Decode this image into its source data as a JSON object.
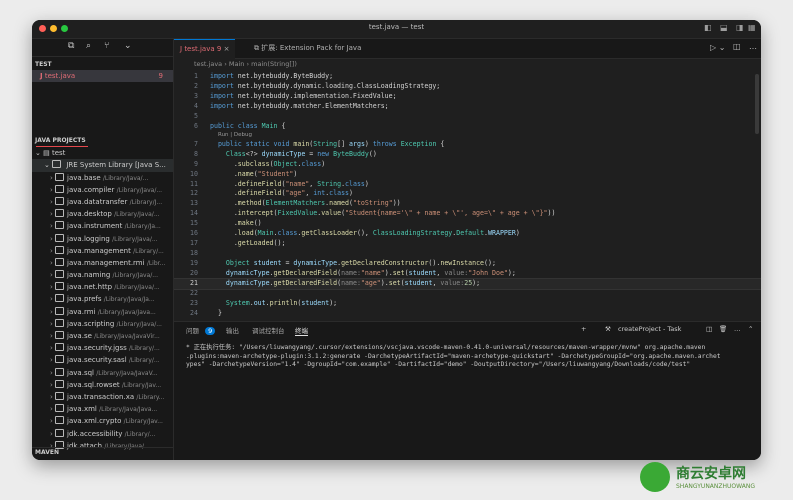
{
  "window": {
    "title": "test.java — test"
  },
  "sidebar": {
    "top_icons": [
      "files-icon",
      "search-icon",
      "branch-icon",
      "chevron-down-icon"
    ],
    "open_section": "TEST",
    "open_file": {
      "name": "test.java",
      "count": "9"
    },
    "java_projects": "JAVA PROJECTS",
    "project": "test",
    "jre": "JRE System Library [Java S...",
    "packages": [
      {
        "name": "java.base",
        "path": "/Library/Java/..."
      },
      {
        "name": "java.compiler",
        "path": "/Library/Java/..."
      },
      {
        "name": "java.datatransfer",
        "path": "/Library/J..."
      },
      {
        "name": "java.desktop",
        "path": "/Library/Java/..."
      },
      {
        "name": "java.instrument",
        "path": "/Library/Ja..."
      },
      {
        "name": "java.logging",
        "path": "/Library/Java/..."
      },
      {
        "name": "java.management",
        "path": "/Library/..."
      },
      {
        "name": "java.management.rmi",
        "path": "/Libr..."
      },
      {
        "name": "java.naming",
        "path": "/Library/Java/..."
      },
      {
        "name": "java.net.http",
        "path": "/Library/Java/..."
      },
      {
        "name": "java.prefs",
        "path": "/Library/Java/Ja..."
      },
      {
        "name": "java.rmi",
        "path": "/Library/Java/Java..."
      },
      {
        "name": "java.scripting",
        "path": "/Library/Java/..."
      },
      {
        "name": "java.se",
        "path": "/Library/Java/JavaVir..."
      },
      {
        "name": "java.security.jgss",
        "path": "/Library/..."
      },
      {
        "name": "java.security.sasl",
        "path": "/Library/..."
      },
      {
        "name": "java.sql",
        "path": "/Library/Java/JavaV..."
      },
      {
        "name": "java.sql.rowset",
        "path": "/Library/Jav..."
      },
      {
        "name": "java.transaction.xa",
        "path": "/Library..."
      },
      {
        "name": "java.xml",
        "path": "/Library/Java/Java..."
      },
      {
        "name": "java.xml.crypto",
        "path": "/Library/Jav..."
      },
      {
        "name": "jdk.accessibility",
        "path": "/Library/..."
      },
      {
        "name": "jdk.attach",
        "path": "/Library/Java/..."
      }
    ],
    "maven": "MAVEN"
  },
  "tabs": [
    {
      "label": "test.java",
      "badge": "9"
    },
    {
      "label": "扩展: Extension Pack for Java"
    }
  ],
  "breadcrumbs": [
    "test.java",
    "Main",
    "main(String[])"
  ],
  "codelens": "Run | Debug",
  "active_line": 21,
  "lines": [
    {
      "n": "1",
      "html": "<span class='kw'>import</span> net.bytebuddy.ByteBuddy;"
    },
    {
      "n": "2",
      "html": "<span class='kw'>import</span> net.bytebuddy.dynamic.loading.ClassLoadingStrategy;"
    },
    {
      "n": "3",
      "html": "<span class='kw'>import</span> net.bytebuddy.implementation.FixedValue;"
    },
    {
      "n": "4",
      "html": "<span class='kw'>import</span> net.bytebuddy.matcher.ElementMatchers;"
    },
    {
      "n": "5",
      "html": ""
    },
    {
      "n": "6",
      "html": "<span class='kw'>public class</span> <span class='ty'>Main</span> {"
    },
    {
      "n": "7",
      "html": "  <span class='kw'>public static void</span> <span class='fn'>main</span>(<span class='ty'>String</span>[] <span class='vr'>args</span>) <span class='kw'>throws</span> <span class='ty'>Exception</span> {"
    },
    {
      "n": "8",
      "html": "    <span class='ty'>Class</span>&lt;?&gt; <span class='vr'>dynamicType</span> = <span class='kw'>new</span> <span class='ty'>ByteBuddy</span>()"
    },
    {
      "n": "9",
      "html": "      .<span class='fn'>subclass</span>(<span class='ty'>Object</span>.<span class='kw'>class</span>)"
    },
    {
      "n": "10",
      "html": "      .<span class='fn'>name</span>(<span class='st'>\"Student\"</span>)"
    },
    {
      "n": "11",
      "html": "      .<span class='fn'>defineField</span>(<span class='st'>\"name\"</span>, <span class='ty'>String</span>.<span class='kw'>class</span>)"
    },
    {
      "n": "12",
      "html": "      .<span class='fn'>defineField</span>(<span class='st'>\"age\"</span>, <span class='kw'>int</span>.<span class='kw'>class</span>)"
    },
    {
      "n": "13",
      "html": "      .<span class='fn'>method</span>(<span class='ty'>ElementMatchers</span>.<span class='fn'>named</span>(<span class='st'>\"toString\"</span>))"
    },
    {
      "n": "14",
      "html": "      .<span class='fn'>intercept</span>(<span class='ty'>FixedValue</span>.<span class='fn'>value</span>(<span class='st'>\"Student{name='\\\" + name + \\\"', age=\\\" + age + \\\"}\"</span>))"
    },
    {
      "n": "15",
      "html": "      .<span class='fn'>make</span>()"
    },
    {
      "n": "16",
      "html": "      .<span class='fn'>load</span>(<span class='ty'>Main</span>.<span class='kw'>class</span>.<span class='fn'>getClassLoader</span>(), <span class='ty'>ClassLoadingStrategy</span>.<span class='ty'>Default</span>.<span class='vr'>WRAPPER</span>)"
    },
    {
      "n": "17",
      "html": "      .<span class='fn'>getLoaded</span>();"
    },
    {
      "n": "18",
      "html": ""
    },
    {
      "n": "19",
      "html": "    <span class='ty'>Object</span> <span class='vr'>student</span> = <span class='vr'>dynamicType</span>.<span class='fn'>getDeclaredConstructor</span>().<span class='fn'>newInstance</span>();"
    },
    {
      "n": "20",
      "html": "    <span class='vr'>dynamicType</span>.<span class='fn'>getDeclaredField</span>(<span class='ht'>name:</span><span class='st'>\"name\"</span>).<span class='fn'>set</span>(<span class='vr'>student</span>, <span class='ht'>value:</span><span class='st'>\"John Doe\"</span>);"
    },
    {
      "n": "21",
      "html": "    <span class='vr'>dynamicType</span>.<span class='fn'>getDeclaredField</span>(<span class='ht'>name:</span><span class='st'>\"age\"</span>).<span class='fn'>set</span>(<span class='vr'>student</span>, <span class='ht'>value:</span><span class='ct'>25</span>);"
    },
    {
      "n": "22",
      "html": ""
    },
    {
      "n": "23",
      "html": "    <span class='ty'>System</span>.<span class='vr'>out</span>.<span class='fn'>println</span>(<span class='vr'>student</span>);"
    },
    {
      "n": "24",
      "html": "  }"
    }
  ],
  "panel": {
    "tabs": [
      {
        "label": "问题",
        "badge": "9"
      },
      {
        "label": "输出"
      },
      {
        "label": "调试控制台"
      },
      {
        "label": "终端"
      }
    ],
    "task": "createProject - Task",
    "terminal": "* 正在执行任务: \"/Users/liuwangyang/.cursor/extensions/vscjava.vscode-maven-0.41.0-universal/resources/maven-wrapper/mvnw\" org.apache.maven\n.plugins:maven-archetype-plugin:3.1.2:generate -DarchetypeArtifactId=\"maven-archetype-quickstart\" -DarchetypeGroupId=\"org.apache.maven.archet\nypes\" -DarchetypeVersion=\"1.4\" -DgroupId=\"com.example\" -DartifactId=\"demo\" -DoutputDirectory=\"/Users/liuwangyang/Downloads/code/test\""
  },
  "watermark": {
    "title": "商云安卓网",
    "url": "SHANGYUNANZHUOWANG"
  }
}
